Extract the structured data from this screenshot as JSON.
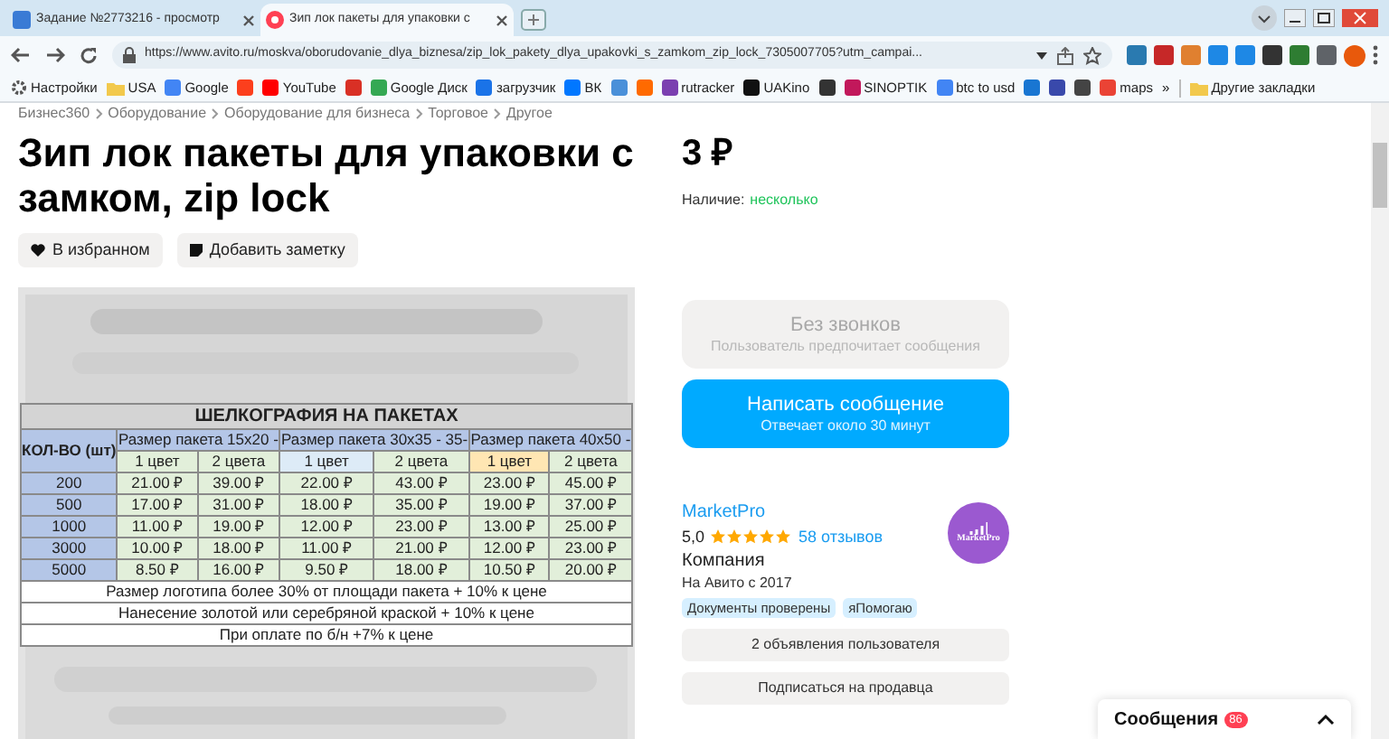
{
  "browser": {
    "tabs": [
      {
        "title": "Задание №2773216 - просмотр",
        "selected": false
      },
      {
        "title": "Зип лок пакеты для упаковки с",
        "selected": true
      }
    ],
    "url": "https://www.avito.ru/moskva/oborudovanie_dlya_biznesa/zip_lok_pakety_dlya_upakovki_s_zamkom_zip_lock_7305007705?utm_campai...",
    "bookmarks": [
      {
        "kind": "gear",
        "label": "Настройки"
      },
      {
        "kind": "folder",
        "label": "USA"
      },
      {
        "kind": "site",
        "label": "Google"
      },
      {
        "kind": "site"
      },
      {
        "kind": "site",
        "label": "YouTube"
      },
      {
        "kind": "site"
      },
      {
        "kind": "site",
        "label": "Google Диск"
      },
      {
        "kind": "site",
        "label": "загрузчик"
      },
      {
        "kind": "site",
        "label": "ВК"
      },
      {
        "kind": "site"
      },
      {
        "kind": "site"
      },
      {
        "kind": "site",
        "label": "rutracker"
      },
      {
        "kind": "site",
        "label": "UAKino"
      },
      {
        "kind": "site"
      },
      {
        "kind": "site",
        "label": "SINOPTIK"
      },
      {
        "kind": "site",
        "label": "btc to usd"
      },
      {
        "kind": "site"
      },
      {
        "kind": "site"
      },
      {
        "kind": "site"
      },
      {
        "kind": "site",
        "label": "maps"
      },
      {
        "kind": "more",
        "label": "»"
      },
      {
        "kind": "folder",
        "label": "Другие закладки"
      }
    ]
  },
  "breadcrumbs": [
    "Бизнес360",
    "Оборудование",
    "Оборудование для бизнеса",
    "Торговое",
    "Другое"
  ],
  "title": "Зип лок пакеты для упаковки с замком, zip lock",
  "actions": [
    {
      "kind": "heart",
      "label": "В избранном"
    },
    {
      "kind": "note",
      "label": "Добавить заметку"
    }
  ],
  "price_table": {
    "title": "ШЕЛКОГРАФИЯ НА ПАКЕТАХ",
    "qty_header": "КОЛ-ВО (шт)",
    "groups": [
      "Размер пакета 15х20 -",
      "Размер пакета 30х35 - 35-",
      "Размер пакета 40х50 -"
    ],
    "subheaders": [
      "1 цвет",
      "2 цвета",
      "1 цвет",
      "2 цвета",
      "1 цвет",
      "2 цвета"
    ],
    "rows": [
      [
        "200",
        "21.00 ₽",
        "39.00 ₽",
        "22.00 ₽",
        "43.00 ₽",
        "23.00 ₽",
        "45.00 ₽"
      ],
      [
        "500",
        "17.00 ₽",
        "31.00 ₽",
        "18.00 ₽",
        "35.00 ₽",
        "19.00 ₽",
        "37.00 ₽"
      ],
      [
        "1000",
        "11.00 ₽",
        "19.00 ₽",
        "12.00 ₽",
        "23.00 ₽",
        "13.00 ₽",
        "25.00 ₽"
      ],
      [
        "3000",
        "10.00 ₽",
        "18.00 ₽",
        "11.00 ₽",
        "21.00 ₽",
        "12.00 ₽",
        "23.00 ₽"
      ],
      [
        "5000",
        "8.50 ₽",
        "16.00 ₽",
        "9.50 ₽",
        "18.00 ₽",
        "10.50 ₽",
        "20.00 ₽"
      ]
    ],
    "notes": [
      "Размер логотипа более 30% от площади пакета + 10% к цене",
      "Нанесение золотой или серебряной краской + 10% к цене",
      "При оплате по б/н +7% к цене"
    ]
  },
  "price": "3 ₽",
  "availability": {
    "label": "Наличие:",
    "value": "несколько"
  },
  "contact_buttons": [
    {
      "title": "Без звонков",
      "subtitle": "Пользователь предпочитает сообщения",
      "disabled": true
    },
    {
      "title": "Написать сообщение",
      "subtitle": "Отвечает около 30 минут",
      "disabled": false
    }
  ],
  "seller": {
    "name": "MarketPro",
    "rating": "5,0",
    "stars": 5,
    "reviews": "58 отзывов",
    "type": "Компания",
    "since": "На Авито с 2017",
    "avatar_text": "MarketPro",
    "tags": [
      "Документы проверены",
      "яПомогаю"
    ],
    "buttons": [
      "2 объявления пользователя",
      "Подписаться на продавца"
    ]
  },
  "messages": {
    "label": "Сообщения",
    "count": "86"
  }
}
